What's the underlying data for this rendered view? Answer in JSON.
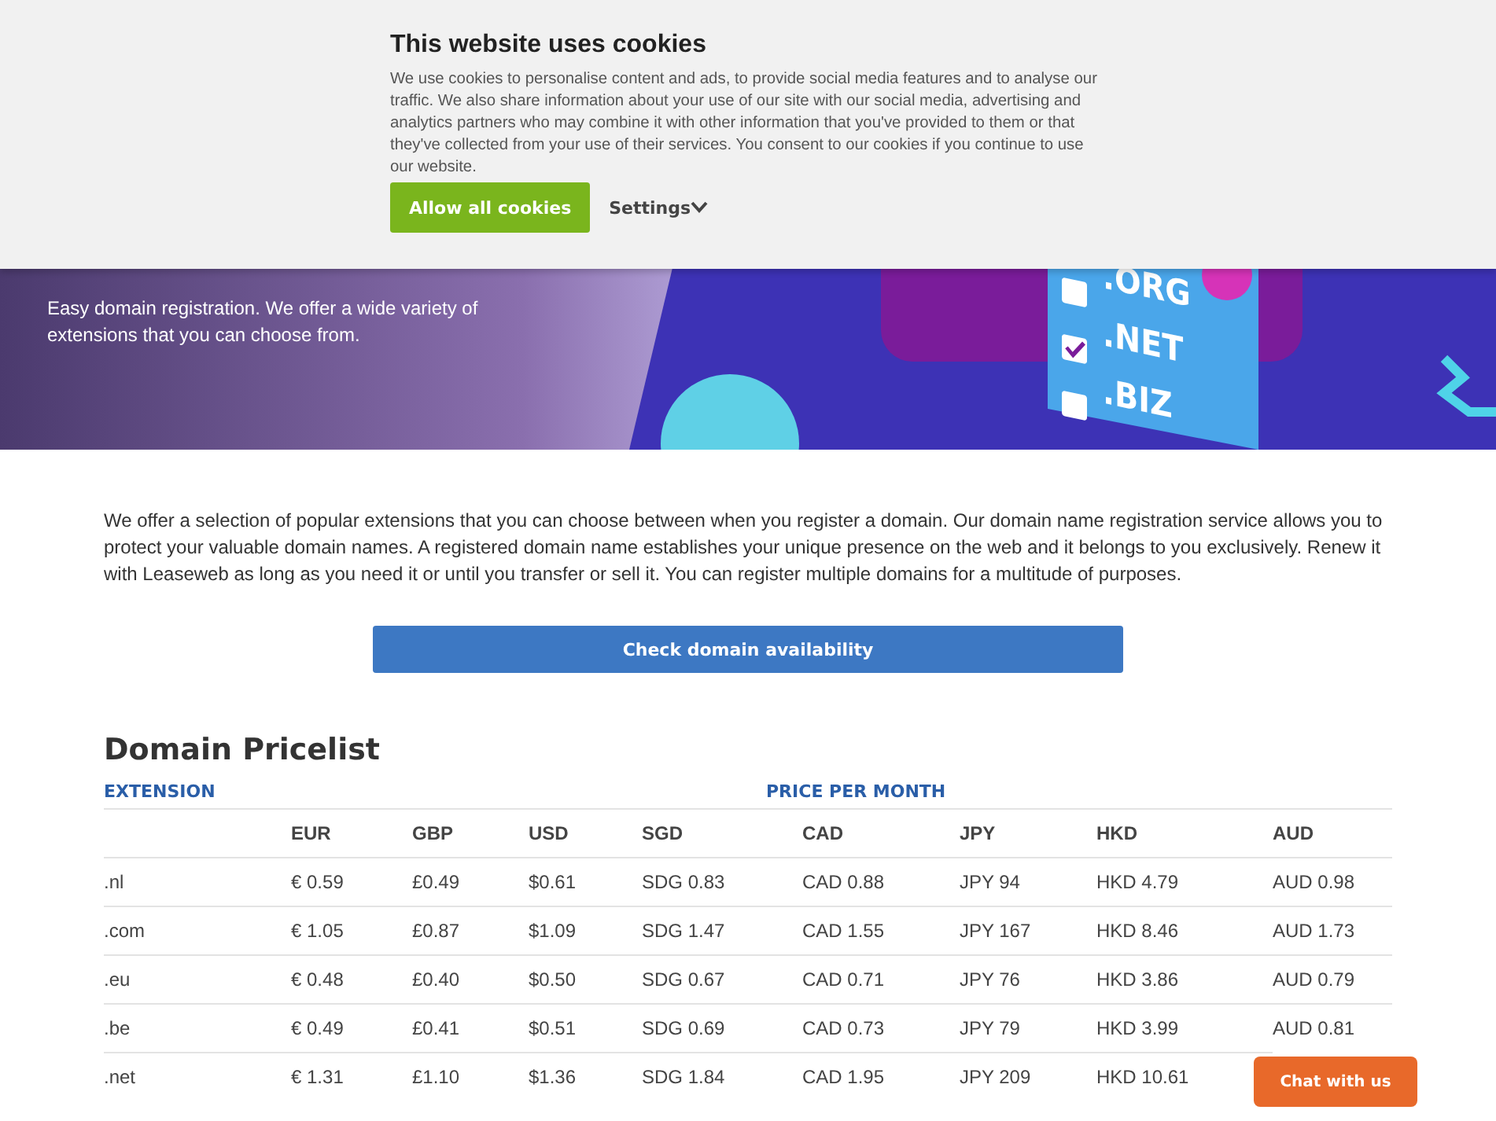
{
  "cookie_banner": {
    "title": "This website uses cookies",
    "text": "We use cookies to personalise content and ads, to provide social media features and to analyse our traffic. We also share information about your use of our site with our social media, advertising and analytics partners who may combine it with other information that you've provided to them or that they've collected from your use of their services. You consent to our cookies if you continue to use our website.",
    "allow_button": "Allow all cookies",
    "settings_button": "Settings",
    "settings_expanded": false
  },
  "hero": {
    "subtitle": "Easy domain registration. We offer a wide variety of extensions that you can choose from.",
    "illustration_labels": [
      {
        "label": ".ORG",
        "checked": false
      },
      {
        "label": ".NET",
        "checked": true
      },
      {
        "label": ".BIZ",
        "checked": false
      }
    ]
  },
  "intro": "We offer a selection of popular extensions that you can choose between when you register a domain. Our domain name registration service allows you to protect your valuable domain names. A registered domain name establishes your unique presence on the web and it belongs to you exclusively. Renew it with Leaseweb as long as you need it or until you transfer or sell it. You can register multiple domains for a multitude of purposes.",
  "check_button": "Check domain availability",
  "pricelist": {
    "title": "Domain Pricelist",
    "group_headers": [
      "EXTENSION",
      "PRICE PER MONTH"
    ],
    "columns": [
      "",
      "EUR",
      "GBP",
      "USD",
      "SGD",
      "CAD",
      "JPY",
      "HKD",
      "AUD"
    ],
    "rows": [
      [
        ".nl",
        "€ 0.59",
        "£0.49",
        "$0.61",
        "SDG 0.83",
        "CAD 0.88",
        "JPY 94",
        "HKD 4.79",
        "AUD 0.98"
      ],
      [
        ".com",
        "€ 1.05",
        "£0.87",
        "$1.09",
        "SDG 1.47",
        "CAD 1.55",
        "JPY 167",
        "HKD 8.46",
        "AUD 1.73"
      ],
      [
        ".eu",
        "€ 0.48",
        "£0.40",
        "$0.50",
        "SDG 0.67",
        "CAD 0.71",
        "JPY 76",
        "HKD 3.86",
        "AUD 0.79"
      ],
      [
        ".be",
        "€ 0.49",
        "£0.41",
        "$0.51",
        "SDG 0.69",
        "CAD 0.73",
        "JPY 79",
        "HKD 3.99",
        "AUD 0.81"
      ],
      [
        ".net",
        "€ 1.31",
        "£1.10",
        "$1.36",
        "SDG 1.84",
        "CAD 1.95",
        "JPY 209",
        "HKD 10.61"
      ]
    ]
  },
  "chat_button": "Chat with us"
}
